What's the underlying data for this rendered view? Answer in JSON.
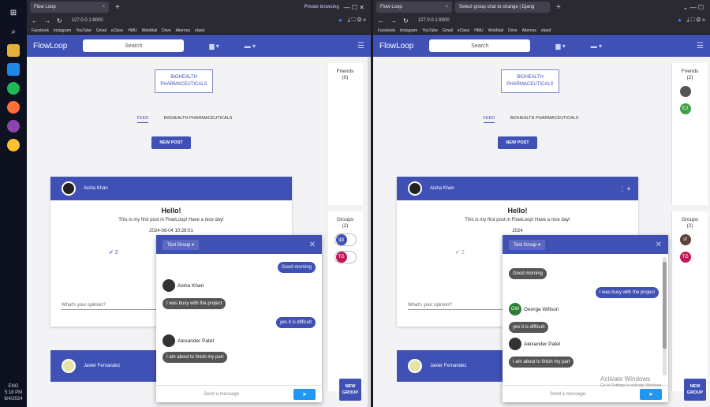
{
  "taskbar": {
    "time": "5:18 PM",
    "date": "6/4/2024",
    "lang": "ENG"
  },
  "left": {
    "tab1": "Flow Loop",
    "private": "Private browsing",
    "url": "127.0.0.1:8000",
    "bookmarks": [
      "Facebook",
      "Instagram",
      "YouTube",
      "Gmail",
      "eClass",
      "HMU",
      "WebMail",
      "Drive",
      "Alternos",
      "eland"
    ],
    "brand": "FlowLoop",
    "search": "Search",
    "org": "BIOHEALTH PHARMACEUTICALS",
    "tab_feed": "FEED",
    "tab_org": "BIOHEALTH PHARMACEUTICALS",
    "new_post": "NEW POST",
    "post_author": "Aisha Khan",
    "post_title": "Hello!",
    "post_body": "This is my first post in FlowLoop! Have a nice day!",
    "post_date": "2024-06-04 10:28:01",
    "likes": "2",
    "opinion": "What's your opinion?",
    "author2": "Javier Fernandez",
    "friends_title": "Friends",
    "friends_count": "(0)",
    "groups_title": "Groups",
    "groups_count": "(2)",
    "group1": "gg",
    "group2": "TG",
    "new_group": "NEW GROUP",
    "chat": {
      "group": "Test Group",
      "m1": "Good morning",
      "s1": "Aisha Khan",
      "m2": "I was busy with the project",
      "m3": "yes it is difficult",
      "s2": "Alexander Patel",
      "m4": "I am about to finish my part",
      "placeholder": "Send a message"
    }
  },
  "right": {
    "tab1": "Flow Loop",
    "tab2": "Select group chat to change | Djang",
    "url": "127.0.0.1:8000",
    "brand": "FlowLoop",
    "search": "Search",
    "org": "BIOHEALTH PHARMACEUTICALS",
    "tab_feed": "FEED",
    "tab_org": "BIOHEALTH PHARMACEUTICALS",
    "new_post": "NEW POST",
    "post_author": "Aisha Khan",
    "post_title": "Hello!",
    "post_body": "This is my first post in FlowLoop! Have a nice day!",
    "post_date": "2024",
    "likes": "2",
    "opinion": "What's your opinion?",
    "author2": "Javier Fernandez",
    "friends_title": "Friends",
    "friends_count": "(2)",
    "friend2": "EJ",
    "groups_title": "Groups",
    "groups_count": "(2)",
    "group1": "sf",
    "group2": "TG",
    "new_group": "NEW GROUP",
    "chat": {
      "group": "Test Group",
      "m1": "Good morning",
      "m2": "I was busy with the project",
      "s1": "George Willson",
      "s1_initials": "GW",
      "m3": "yes it is difficult",
      "s2": "Alexander Patel",
      "m4": "I am about to finish my part",
      "placeholder": "Send a message"
    },
    "activate_title": "Activate Windows",
    "activate_sub": "Go to Settings to activate Windows."
  }
}
